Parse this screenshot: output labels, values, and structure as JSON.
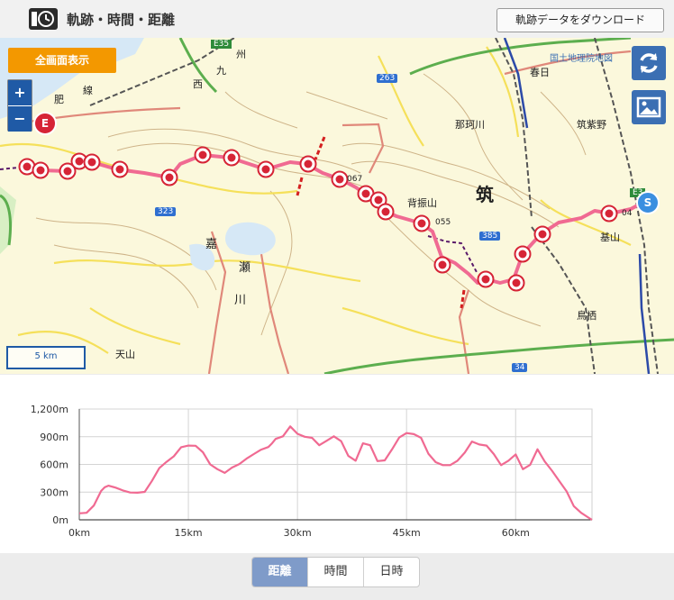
{
  "header": {
    "title": "軌跡・時間・距離",
    "download_label": "軌跡データをダウンロード"
  },
  "map": {
    "fullscreen_label": "全画面表示",
    "zoom_in": "+",
    "zoom_out": "−",
    "scale_label": "5 km",
    "attribution": "国土地理院地図",
    "start_marker": "S",
    "end_marker": "E",
    "labels": {
      "kasuga": "春日",
      "nakagawa": "那珂川",
      "chikushino": "筑紫野",
      "sefuri": "背振山",
      "chiku": "筑",
      "kiyama": "基山",
      "tosu": "鳥栖",
      "amayama": "天山",
      "kaseriver": "嘉",
      "kaseriver2": "瀬",
      "kaseriver3": "川",
      "hizen1": "肥",
      "hizen2": "線",
      "nishi": "西",
      "kyu": "九",
      "shu": "州",
      "h1055": "055",
      "h1067": "067",
      "e35": "E35",
      "r263": "263",
      "r323": "323",
      "r385": "385",
      "r34": "34",
      "e3": "E3",
      "h04": "04"
    }
  },
  "chart_data": {
    "type": "area",
    "xlabel": "",
    "ylabel": "",
    "x_ticks": [
      "0km",
      "15km",
      "30km",
      "45km",
      "60km"
    ],
    "y_ticks": [
      "0m",
      "300m",
      "600m",
      "900m",
      "1,200m"
    ],
    "xlim": [
      0,
      70.5
    ],
    "ylim": [
      0,
      1200
    ],
    "grid": true,
    "color": "#f06a92",
    "x": [
      0,
      1,
      2,
      3,
      3.5,
      4,
      5,
      6,
      7,
      8,
      9,
      10,
      11,
      12,
      13,
      14,
      15,
      16,
      17,
      18,
      19,
      20,
      21,
      22,
      23,
      24,
      25,
      26,
      26.5,
      27,
      28,
      29,
      30,
      31,
      32,
      33,
      34,
      35,
      36,
      37,
      38,
      39,
      40,
      41,
      42,
      43,
      44,
      45,
      46,
      47,
      48,
      49,
      50,
      51,
      52,
      53,
      54,
      55,
      56,
      57,
      58,
      59,
      60,
      61,
      62,
      63,
      64,
      65,
      66,
      67,
      68,
      69,
      70,
      70.5
    ],
    "y": [
      70,
      80,
      150,
      300,
      360,
      370,
      340,
      330,
      300,
      290,
      290,
      430,
      560,
      620,
      700,
      790,
      800,
      790,
      740,
      600,
      540,
      520,
      570,
      600,
      650,
      720,
      760,
      780,
      840,
      880,
      900,
      1000,
      940,
      900,
      880,
      820,
      860,
      900,
      840,
      700,
      640,
      820,
      820,
      640,
      640,
      750,
      900,
      940,
      920,
      900,
      720,
      620,
      580,
      600,
      640,
      720,
      860,
      820,
      800,
      700,
      600,
      640,
      700,
      560,
      600,
      760,
      620,
      540,
      420,
      300,
      160,
      80,
      20,
      0
    ]
  },
  "tabs": [
    {
      "label": "距離"
    },
    {
      "label": "時間"
    },
    {
      "label": "日時"
    }
  ]
}
